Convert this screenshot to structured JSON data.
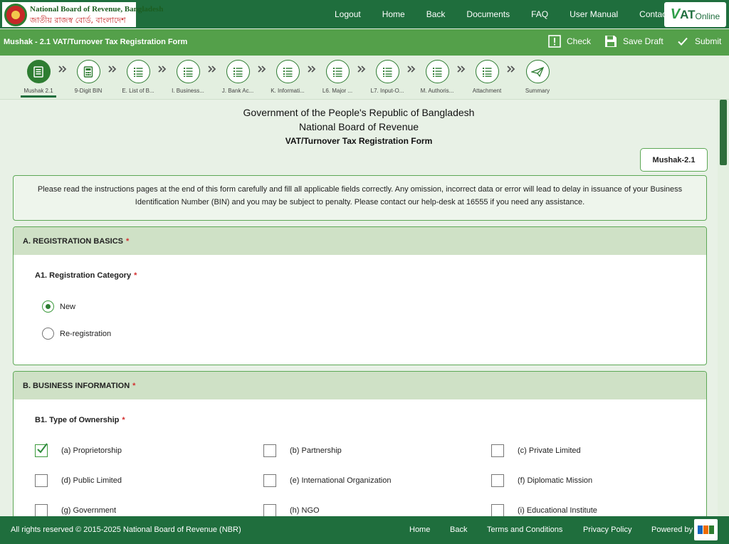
{
  "header": {
    "logo_en": "National Board of Revenue, Bangladesh",
    "logo_bn": "জাতীয় রাজস্ব বোর্ড, বাংলাদেশ",
    "nav": [
      "Logout",
      "Home",
      "Back",
      "Documents",
      "FAQ",
      "User Manual",
      "Contact"
    ],
    "vat_logo_v": "V",
    "vat_logo_at": "AT",
    "vat_logo_online": "Online"
  },
  "form_bar": {
    "title": "Mushak - 2.1 VAT/Turnover Tax Registration Form",
    "check": "Check",
    "save_draft": "Save Draft",
    "submit": "Submit"
  },
  "stepper": {
    "separator": "»",
    "steps": [
      {
        "label": "Mushak 2.1",
        "icon": "form-doc-icon",
        "active": true
      },
      {
        "label": "9-Digit BIN",
        "icon": "calculator-icon",
        "active": false
      },
      {
        "label": "E. List of B...",
        "icon": "list-icon",
        "active": false
      },
      {
        "label": "I. Business...",
        "icon": "list-icon",
        "active": false
      },
      {
        "label": "J. Bank Ac...",
        "icon": "list-icon",
        "active": false
      },
      {
        "label": "K. Informati...",
        "icon": "list-icon",
        "active": false
      },
      {
        "label": "L6. Major ...",
        "icon": "list-icon",
        "active": false
      },
      {
        "label": "L7. Input-O...",
        "icon": "list-icon",
        "active": false
      },
      {
        "label": "M. Authoris...",
        "icon": "list-icon",
        "active": false
      },
      {
        "label": "Attachment",
        "icon": "list-icon",
        "active": false
      },
      {
        "label": "Summary",
        "icon": "paper-plane-icon",
        "active": false
      }
    ]
  },
  "doc_header": {
    "line1": "Government of the People's Republic of Bangladesh",
    "line2": "National Board of Revenue",
    "line3": "VAT/Turnover Tax Registration Form",
    "badge": "Mushak-2.1"
  },
  "instructions": "Please read the instructions pages at the end of this form carefully and fill all applicable fields correctly. Any omission, incorrect data or error will lead to delay in issuance of your Business Identification Number (BIN) and you may be subject to penalty. Please contact our help-desk at 16555 if you need any assistance.",
  "required_mark": "*",
  "section_a": {
    "title": "A. REGISTRATION BASICS",
    "field_label": "A1. Registration Category",
    "options": [
      {
        "label": "New",
        "checked": true
      },
      {
        "label": "Re-registration",
        "checked": false
      }
    ]
  },
  "section_b": {
    "title": "B. BUSINESS INFORMATION",
    "field_label": "B1. Type of Ownership",
    "options": [
      {
        "label": "(a) Proprietorship",
        "checked": true
      },
      {
        "label": "(b) Partnership",
        "checked": false
      },
      {
        "label": "(c) Private Limited",
        "checked": false
      },
      {
        "label": "(d) Public Limited",
        "checked": false
      },
      {
        "label": "(e) International Organization",
        "checked": false
      },
      {
        "label": "(f) Diplomatic Mission",
        "checked": false
      },
      {
        "label": "(g) Government",
        "checked": false
      },
      {
        "label": "(h) NGO",
        "checked": false
      },
      {
        "label": "(i) Educational Institute",
        "checked": false
      }
    ]
  },
  "footer": {
    "copyright": "All rights reserved © 2015-2025 National Board of Revenue (NBR)",
    "links": [
      "Home",
      "Back",
      "Terms and Conditions",
      "Privacy Policy"
    ],
    "powered_by": "Powered by"
  },
  "colors": {
    "primary": "#1f6e3d",
    "bar": "#54a04a",
    "accent": "#2e7d32",
    "section_head": "#cfe1c6",
    "required": "#d32f2f"
  }
}
